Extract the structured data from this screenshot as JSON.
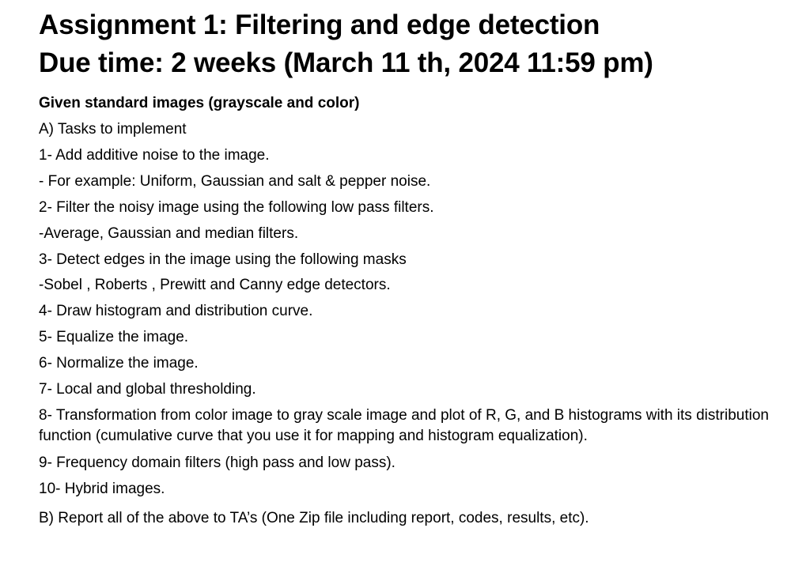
{
  "header": {
    "title": "Assignment 1:  Filtering and edge detection",
    "due": "Due time: 2 weeks (March 11 th, 2024 11:59 pm)"
  },
  "body": {
    "intro": "Given standard images (grayscale and color)",
    "section_a": "A) Tasks to implement",
    "items": [
      "1- Add additive noise to the image.",
      "- For example: Uniform, Gaussian and salt & pepper noise.",
      "2- Filter the noisy image using the following low pass filters.",
      "-Average, Gaussian and median filters.",
      "3- Detect edges in the image using the following masks",
      "-Sobel , Roberts , Prewitt and Canny edge detectors.",
      "4- Draw histogram and distribution curve.",
      "5- Equalize the image.",
      "6- Normalize the image.",
      "7- Local and global thresholding.",
      "8- Transformation from color image to gray scale image and plot of R, G, and B histograms with its distribution function (cumulative curve that you use it for mapping and histogram equalization).",
      "9- Frequency domain filters (high pass and low pass).",
      "10- Hybrid images."
    ],
    "section_b": "B) Report all of the above to TA’s (One Zip file including report, codes, results, etc)."
  }
}
